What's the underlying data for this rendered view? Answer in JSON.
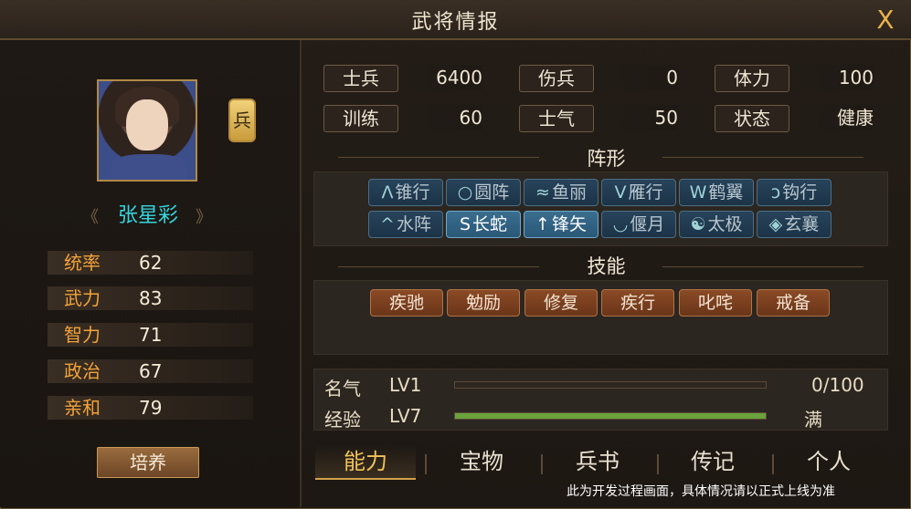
{
  "window": {
    "title": "武将情报",
    "close_label": "X"
  },
  "general": {
    "name": "张星彩",
    "unit_badge": "兵",
    "train_button": "培养"
  },
  "attributes": [
    {
      "label": "统率",
      "value": "62"
    },
    {
      "label": "武力",
      "value": "83"
    },
    {
      "label": "智力",
      "value": "71"
    },
    {
      "label": "政治",
      "value": "67"
    },
    {
      "label": "亲和",
      "value": "79"
    }
  ],
  "status": [
    {
      "label": "士兵",
      "value": "6400"
    },
    {
      "label": "伤兵",
      "value": "0"
    },
    {
      "label": "体力",
      "value": "100"
    },
    {
      "label": "训练",
      "value": "60"
    },
    {
      "label": "士气",
      "value": "50"
    },
    {
      "label": "状态",
      "value": "健康"
    }
  ],
  "formation": {
    "title": "阵形",
    "items": [
      {
        "label": "锥行",
        "icon": "Λ",
        "active": false
      },
      {
        "label": "圆阵",
        "icon": "○",
        "active": false
      },
      {
        "label": "鱼丽",
        "icon": "≈",
        "active": false
      },
      {
        "label": "雁行",
        "icon": "V",
        "active": false
      },
      {
        "label": "鹤翼",
        "icon": "W",
        "active": false
      },
      {
        "label": "钩行",
        "icon": "ɔ",
        "active": false
      },
      {
        "label": "水阵",
        "icon": "^",
        "active": false
      },
      {
        "label": "长蛇",
        "icon": "S",
        "active": true
      },
      {
        "label": "锋矢",
        "icon": "↑",
        "active": true
      },
      {
        "label": "偃月",
        "icon": "◡",
        "active": false
      },
      {
        "label": "太极",
        "icon": "☯",
        "active": false
      },
      {
        "label": "玄襄",
        "icon": "◈",
        "active": false
      }
    ]
  },
  "skills": {
    "title": "技能",
    "items": [
      "疾驰",
      "勉励",
      "修复",
      "疾行",
      "叱咤",
      "戒备"
    ]
  },
  "fame": {
    "label": "名气",
    "level": "LV1",
    "progress_text": "0/100",
    "progress": 0.0
  },
  "exp": {
    "label": "经验",
    "level": "LV7",
    "progress_text": "满",
    "progress": 1.0
  },
  "tabs": [
    {
      "label": "能力",
      "active": true
    },
    {
      "label": "宝物",
      "active": false
    },
    {
      "label": "兵书",
      "active": false
    },
    {
      "label": "传记",
      "active": false
    },
    {
      "label": "个人",
      "active": false
    }
  ],
  "notice": "此为开发过程画面，具体情况请以正式上线为准"
}
